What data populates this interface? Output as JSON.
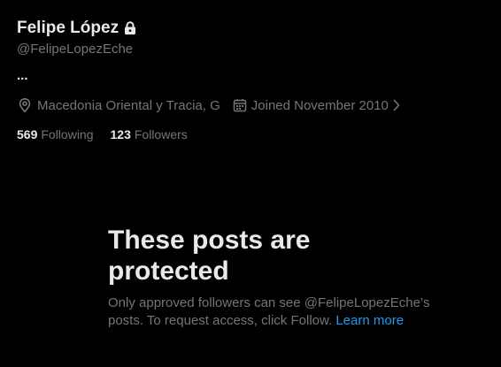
{
  "profile": {
    "display_name": "Felipe López",
    "handle": "@FelipeLopezEche",
    "bio": "...",
    "location": "Macedonia Oriental y Tracia, G",
    "joined": "Joined November 2010",
    "following_count": "569",
    "following_label": "Following",
    "followers_count": "123",
    "followers_label": "Followers",
    "lock_icon": "lock-icon",
    "location_icon": "location-pin-icon",
    "calendar_icon": "calendar-icon",
    "chevron_icon": "chevron-right-icon"
  },
  "protected_notice": {
    "title": "These posts are protected",
    "body": "Only approved followers can see @FelipeLopezEche’s posts. To request access, click Follow.",
    "learn_more": "Learn more"
  },
  "colors": {
    "background": "#000000",
    "primary_text": "#e7e9ea",
    "secondary_text": "#71767b",
    "link": "#1d9bf0"
  }
}
